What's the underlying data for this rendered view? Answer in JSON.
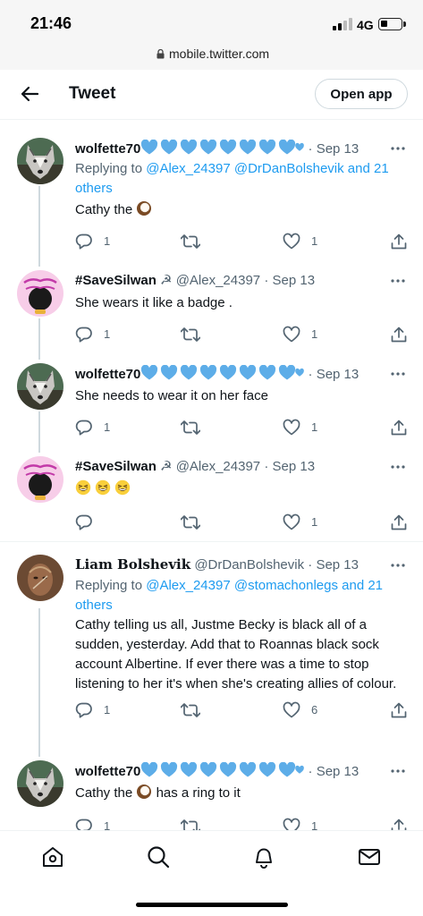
{
  "status_bar": {
    "time": "21:46",
    "network": "4G"
  },
  "browser": {
    "url": "mobile.twitter.com"
  },
  "header": {
    "title": "Tweet",
    "open_app_label": "Open app"
  },
  "tweets": [
    {
      "name": "wolfette70",
      "handle": "",
      "time": "Sep 13",
      "reply_prefix": "Replying to ",
      "reply_handles": "@Alex_24397 @DrDanBolshevik and 21 others",
      "text": "Cathy the",
      "emoji": "coconut-icon",
      "replies": "1",
      "retweets": "",
      "likes": "1"
    },
    {
      "name": "#SaveSilwan",
      "handle": "@Alex_24397",
      "time": "Sep 13",
      "text": "She wears it like a badge .",
      "replies": "1",
      "retweets": "",
      "likes": "1"
    },
    {
      "name": "wolfette70",
      "handle": "",
      "time": "Sep 13",
      "text": "She needs to wear it on her face",
      "replies": "1",
      "retweets": "",
      "likes": "1"
    },
    {
      "name": "#SaveSilwan",
      "handle": "@Alex_24397",
      "time": "Sep 13",
      "text": "",
      "emoji": "grinning-squinting-face-icon",
      "replies": "",
      "retweets": "",
      "likes": "1"
    },
    {
      "name": "Liam Bolshevik",
      "handle": "@DrDanBolshevik",
      "time": "Sep 13",
      "reply_prefix": "Replying to ",
      "reply_handles": "@Alex_24397 @stomachonlegs and 21 others",
      "text": "Cathy telling us all, Justme Becky is black all of a sudden, yesterday. Add that to Roannas black sock account Albertine. If ever there was a time to stop listening to her it's when she's creating allies of colour.",
      "replies": "1",
      "retweets": "",
      "likes": "6"
    },
    {
      "name": "wolfette70",
      "handle": "",
      "time": "Sep 13",
      "text_before": "Cathy the",
      "text_after": "has a ring to it",
      "replies": "1",
      "retweets": "",
      "likes": "1"
    }
  ],
  "colors": {
    "accent": "#1d9bf0",
    "muted": "#536471",
    "border": "#eff3f4"
  },
  "nav": [
    "home-icon",
    "search-icon",
    "notifications-icon",
    "messages-icon"
  ]
}
